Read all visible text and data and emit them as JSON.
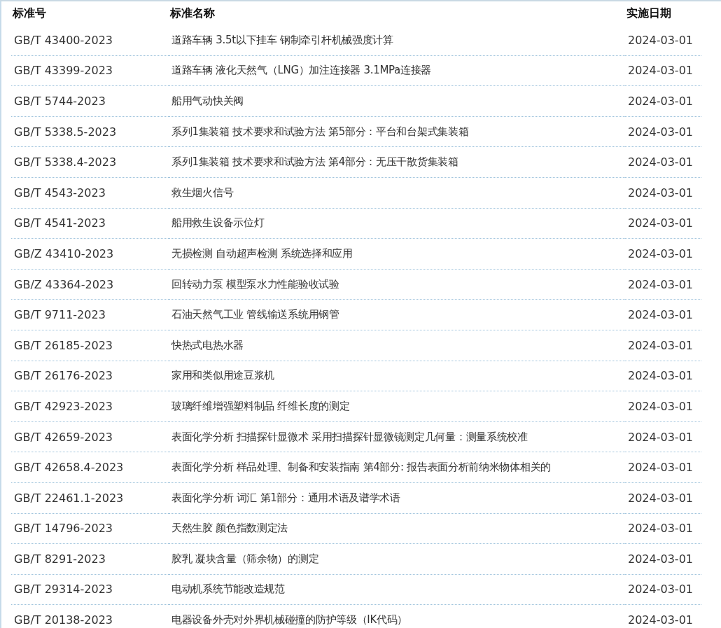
{
  "table": {
    "columns": [
      "标准号",
      "标准名称",
      "实施日期"
    ],
    "rows": [
      {
        "code": "GB/T 43400-2023",
        "name": "道路车辆 3.5t以下挂车 钢制牵引杆机械强度计算",
        "date": "2024-03-01"
      },
      {
        "code": "GB/T 43399-2023",
        "name": "道路车辆 液化天然气（LNG）加注连接器 3.1MPa连接器",
        "date": "2024-03-01"
      },
      {
        "code": "GB/T 5744-2023",
        "name": "船用气动快关阀",
        "date": "2024-03-01"
      },
      {
        "code": "GB/T 5338.5-2023",
        "name": "系列1集装箱 技术要求和试验方法 第5部分：平台和台架式集装箱",
        "date": "2024-03-01"
      },
      {
        "code": "GB/T 5338.4-2023",
        "name": "系列1集装箱 技术要求和试验方法 第4部分：无压干散货集装箱",
        "date": "2024-03-01"
      },
      {
        "code": "GB/T 4543-2023",
        "name": "救生烟火信号",
        "date": "2024-03-01"
      },
      {
        "code": "GB/T 4541-2023",
        "name": "船用救生设备示位灯",
        "date": "2024-03-01"
      },
      {
        "code": "GB/Z 43410-2023",
        "name": "无损检测 自动超声检测 系统选择和应用",
        "date": "2024-03-01"
      },
      {
        "code": "GB/Z 43364-2023",
        "name": "回转动力泵 模型泵水力性能验收试验",
        "date": "2024-03-01"
      },
      {
        "code": "GB/T 9711-2023",
        "name": "石油天然气工业 管线输送系统用钢管",
        "date": "2024-03-01"
      },
      {
        "code": "GB/T 26185-2023",
        "name": "快热式电热水器",
        "date": "2024-03-01"
      },
      {
        "code": "GB/T 26176-2023",
        "name": "家用和类似用途豆浆机",
        "date": "2024-03-01"
      },
      {
        "code": "GB/T 42923-2023",
        "name": "玻璃纤维增强塑料制品 纤维长度的测定",
        "date": "2024-03-01"
      },
      {
        "code": "GB/T 42659-2023",
        "name": "表面化学分析 扫描探针显微术 采用扫描探针显微镜测定几何量：测量系统校准",
        "date": "2024-03-01"
      },
      {
        "code": "GB/T 42658.4-2023",
        "name": "表面化学分析 样品处理、制备和安装指南 第4部分: 报告表面分析前纳米物体相关的",
        "date": "2024-03-01"
      },
      {
        "code": "GB/T 22461.1-2023",
        "name": "表面化学分析 词汇 第1部分：通用术语及谱学术语",
        "date": "2024-03-01"
      },
      {
        "code": "GB/T 14796-2023",
        "name": "天然生胶 颜色指数测定法",
        "date": "2024-03-01"
      },
      {
        "code": "GB/T 8291-2023",
        "name": "胶乳 凝块含量（筛余物）的测定",
        "date": "2024-03-01"
      },
      {
        "code": "GB/T 29314-2023",
        "name": "电动机系统节能改造规范",
        "date": "2024-03-01"
      },
      {
        "code": "GB/T 20138-2023",
        "name": "电器设备外壳对外界机械碰撞的防护等级（IK代码）",
        "date": "2024-03-01"
      }
    ]
  }
}
